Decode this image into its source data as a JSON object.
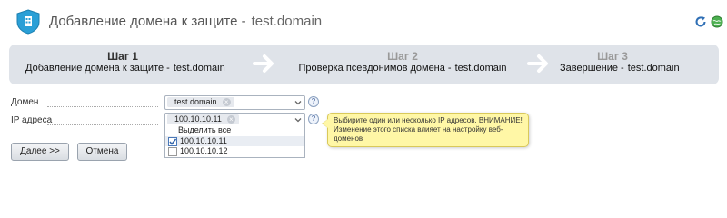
{
  "header": {
    "title": "Добавление домена к защите -",
    "domain": "test.domain"
  },
  "steps": [
    {
      "num": "Шаг 1",
      "label": "Добавление домена к защите -",
      "domain": "test.domain"
    },
    {
      "num": "Шаг 2",
      "label": "Проверка псевдонимов домена -",
      "domain": "test.domain"
    },
    {
      "num": "Шаг 3",
      "label": "Завершение -",
      "domain": "test.domain"
    }
  ],
  "form": {
    "domain_label": "Домен",
    "domain_value": "test.domain",
    "ip_label": "IP адреса",
    "ip_value": "100.10.10.11",
    "help_glyph": "?"
  },
  "dropdown": {
    "select_all": "Выделить все",
    "options": [
      {
        "label": "100.10.10.11",
        "checked": true
      },
      {
        "label": "100.10.10.12",
        "checked": false
      }
    ]
  },
  "tooltip": {
    "text": "Выбирите один или несколько IP адресов. ВНИМАНИЕ! Изменение этого списка влияет на настройку веб-доменов"
  },
  "buttons": {
    "next": "Далее >>",
    "cancel": "Отмена"
  },
  "colors": {
    "steps_bg": "#dfe3e9",
    "shield": "#2a9fd6",
    "tooltip_bg": "#fff7a6"
  }
}
